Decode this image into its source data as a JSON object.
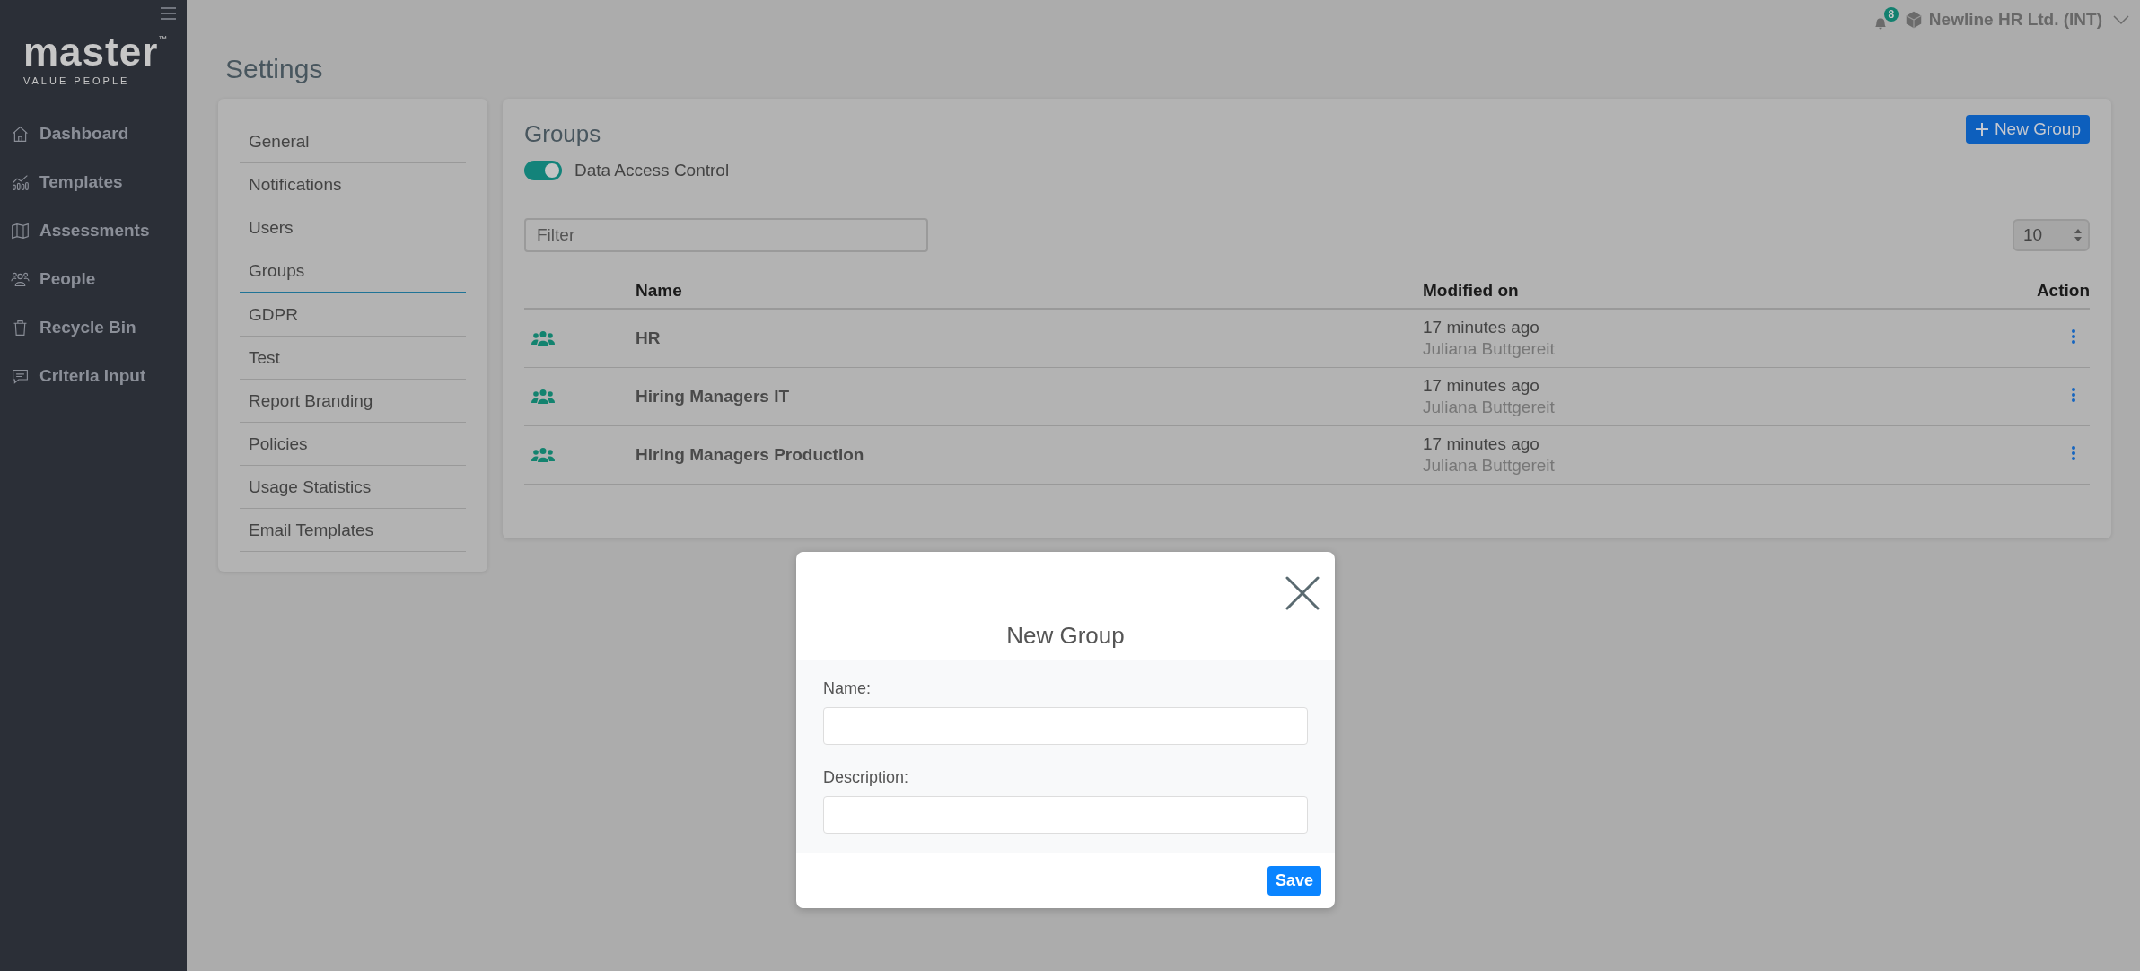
{
  "sidebar": {
    "logo": {
      "wordmark": "master",
      "trademark": "™",
      "tagline": "VALUE PEOPLE"
    },
    "items": [
      {
        "label": "Dashboard",
        "selected": false
      },
      {
        "label": "Templates",
        "selected": false
      },
      {
        "label": "Assessments",
        "selected": false
      },
      {
        "label": "People",
        "selected": false
      },
      {
        "label": "Recycle Bin",
        "selected": false
      },
      {
        "label": "Criteria Input",
        "selected": false
      }
    ]
  },
  "topbar": {
    "notification_count": "8",
    "company": "Newline HR Ltd. (INT)"
  },
  "page_title": "Settings",
  "settings_nav": [
    {
      "label": "General",
      "selected": false
    },
    {
      "label": "Notifications",
      "selected": false
    },
    {
      "label": "Users",
      "selected": false
    },
    {
      "label": "Groups",
      "selected": true
    },
    {
      "label": "GDPR",
      "selected": false
    },
    {
      "label": "Test",
      "selected": false
    },
    {
      "label": "Report Branding",
      "selected": false
    },
    {
      "label": "Policies",
      "selected": false
    },
    {
      "label": "Usage Statistics",
      "selected": false
    },
    {
      "label": "Email Templates",
      "selected": false
    }
  ],
  "groups_panel": {
    "title": "Groups",
    "new_button": "New Group",
    "toggle": {
      "label": "Data Access Control",
      "on": true
    },
    "filter": {
      "placeholder": "Filter"
    },
    "page_size": "10",
    "table": {
      "columns": [
        "Name",
        "Modified on",
        "Action"
      ],
      "rows": [
        {
          "name": "HR",
          "modified": "17 minutes ago",
          "modified_by": "Juliana Buttgereit"
        },
        {
          "name": "Hiring Managers IT",
          "modified": "17 minutes ago",
          "modified_by": "Juliana Buttgereit"
        },
        {
          "name": "Hiring Managers Production",
          "modified": "17 minutes ago",
          "modified_by": "Juliana Buttgereit"
        }
      ]
    }
  },
  "dialog": {
    "title": "New Group",
    "fields": [
      {
        "label": "Name:"
      },
      {
        "label": "Description:"
      }
    ],
    "save_button": "Save"
  }
}
